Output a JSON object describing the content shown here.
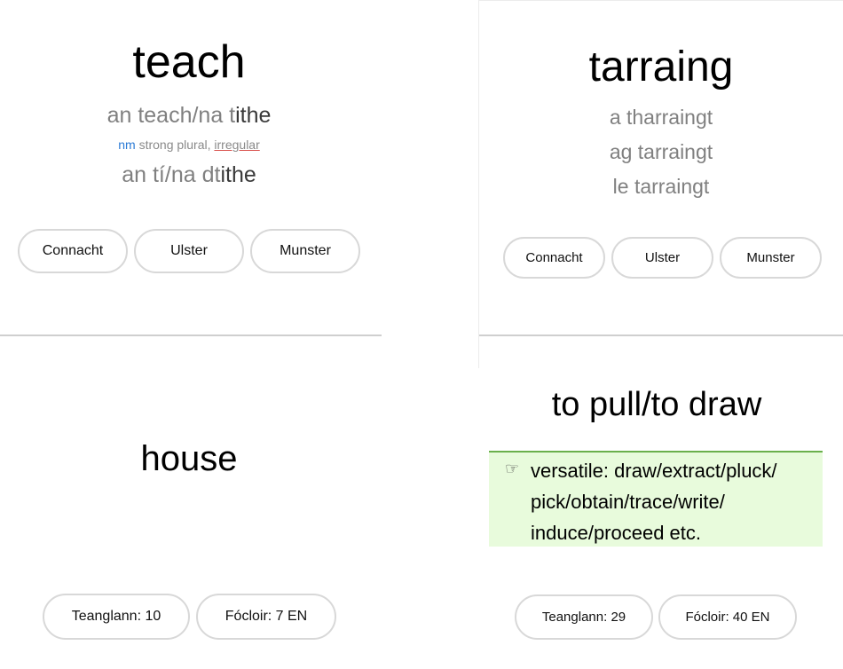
{
  "card_left_top": {
    "headword": "teach",
    "singular_prefix": "an teach/na t",
    "singular_suffix": "ithe",
    "gender": "nm",
    "grammar_plain": "strong plural,",
    "grammar_link": "irregular",
    "genitive_prefix": "an tí/na dt",
    "genitive_suffix": "ithe",
    "buttons": [
      "Connacht",
      "Ulster",
      "Munster"
    ]
  },
  "card_right_top": {
    "headword": "tarraing",
    "forms": [
      "a tharraingt",
      "ag tarraingt",
      "le tarraingt"
    ],
    "buttons": [
      "Connacht",
      "Ulster",
      "Munster"
    ]
  },
  "card_left_bottom": {
    "translation": "house",
    "buttons": [
      "Teanglann: 10",
      "Fócloir: 7 EN"
    ]
  },
  "card_right_bottom": {
    "translation": "to pull/to draw",
    "note_icon": "☞",
    "note_lines": [
      "versatile: draw/extract/pluck/",
      "pick/obtain/trace/write/",
      "induce/proceed etc."
    ],
    "buttons": [
      "Teanglann: 29",
      "Fócloir: 40 EN"
    ]
  },
  "colors": {
    "gender": "#2b7bd6",
    "link_underline": "#d9534f",
    "note_bg": "#e8fbdc",
    "note_border": "#6ab04c"
  }
}
